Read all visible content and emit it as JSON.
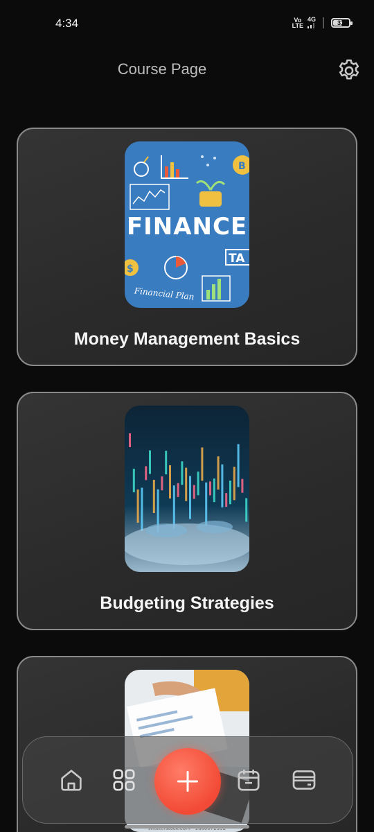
{
  "status_bar": {
    "time": "4:34",
    "volte_top": "Vo",
    "volte_bottom": "LTE",
    "network": "4G",
    "battery": "31"
  },
  "header": {
    "title": "Course Page",
    "settings_icon": "gear-icon"
  },
  "courses": [
    {
      "title": "Money Management Basics",
      "image_text": "FINANCE",
      "image_caption": "Financial Plan",
      "image_tag": "TA"
    },
    {
      "title": "Budgeting Strategies"
    },
    {
      "title": "",
      "image_watermark": "shutterstock.com · 1660072392"
    }
  ],
  "bottom_nav": {
    "items": [
      {
        "icon": "home-icon"
      },
      {
        "icon": "grid-icon"
      },
      {
        "icon": "plus-icon"
      },
      {
        "icon": "calendar-icon"
      },
      {
        "icon": "wallet-icon"
      }
    ]
  },
  "colors": {
    "background": "#0b0b0b",
    "card_border": "#8a8a8a",
    "fab": "#f24a35",
    "finance_blue": "#3a7cc0"
  }
}
